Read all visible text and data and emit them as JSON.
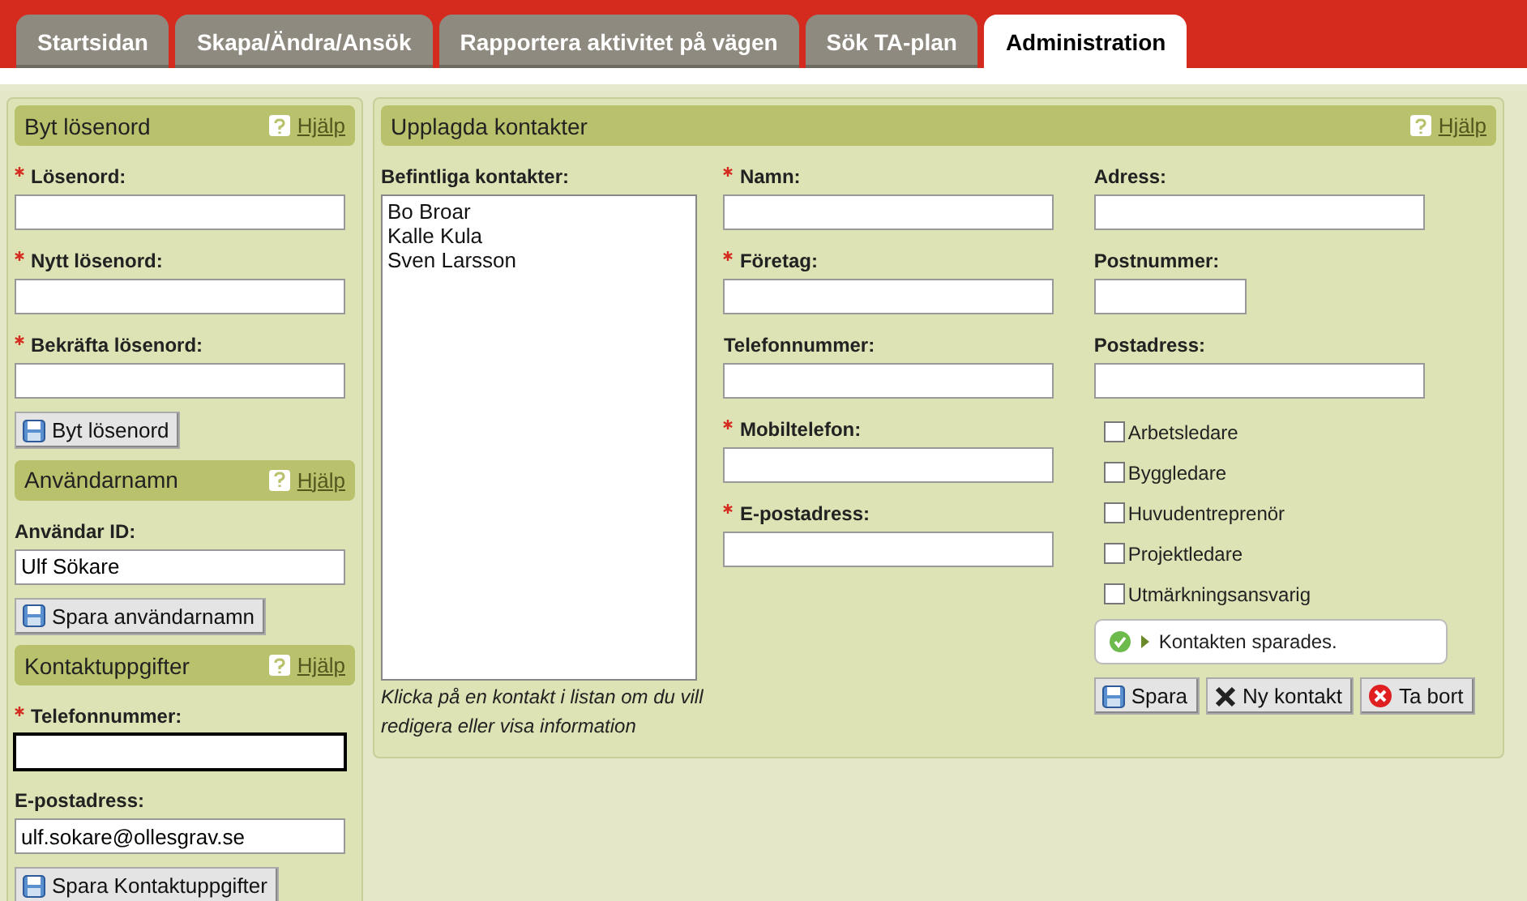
{
  "tabs": [
    {
      "label": "Startsidan",
      "selected": false
    },
    {
      "label": "Skapa/Ändra/Ansök",
      "selected": false
    },
    {
      "label": "Rapportera aktivitet på vägen",
      "selected": false
    },
    {
      "label": "Sök TA-plan",
      "selected": false
    },
    {
      "label": "Administration",
      "selected": true
    }
  ],
  "sidebar": {
    "panels": [
      {
        "title": "Byt lösenord",
        "help": "Hjälp",
        "fields": [
          {
            "label": "Lösenord:",
            "required": true,
            "focused": false
          },
          {
            "label": "Nytt lösenord:",
            "required": true,
            "focused": false
          },
          {
            "label": "Bekräfta lösenord:",
            "required": true,
            "focused": false
          }
        ],
        "button": "Byt lösenord"
      },
      {
        "title": "Användarnamn",
        "help": "Hjälp",
        "fields": [
          {
            "label": "Användar ID:",
            "required": false,
            "value": "Ulf Sökare",
            "focused": false
          }
        ],
        "button": "Spara användarnamn"
      },
      {
        "title": "Kontaktuppgifter",
        "help": "Hjälp",
        "fields": [
          {
            "label": "Telefonnummer:",
            "required": true,
            "focused": true
          },
          {
            "label": "E-postadress:",
            "required": false,
            "value": "ulf.sokare@ollesgrav.se",
            "focused": false
          }
        ],
        "button": "Spara Kontaktuppgifter"
      }
    ]
  },
  "contacts": {
    "title": "Upplagda kontakter",
    "help": "Hjälp",
    "list_label": "Befintliga kontakter:",
    "list": [
      {
        "name": "Bo Broar",
        "selected": false
      },
      {
        "name": "Kalle Kula",
        "selected": false
      },
      {
        "name": "Sven Larsson",
        "selected": false
      }
    ],
    "list_hint": "Klicka på en kontakt i listan om du vill redigera eller visa information",
    "fields": [
      {
        "label": "Namn:",
        "required": true
      },
      {
        "label": "Företag:",
        "required": true
      },
      {
        "label": "Telefonnummer:",
        "required": false
      },
      {
        "label": "Mobiltelefon:",
        "required": true
      },
      {
        "label": "E-postadress:",
        "required": true
      }
    ],
    "address_fields": [
      {
        "label": "Adress:",
        "required": false,
        "kind": "wide"
      },
      {
        "label": "Postnummer:",
        "required": false,
        "kind": "short"
      },
      {
        "label": "Postadress:",
        "required": false,
        "kind": "wide"
      }
    ],
    "roles": [
      {
        "label": "Arbetsledare",
        "checked": false
      },
      {
        "label": "Byggledare",
        "checked": false
      },
      {
        "label": "Huvudentreprenör",
        "checked": false
      },
      {
        "label": "Projektledare",
        "checked": false
      },
      {
        "label": "Utmärkningsansvarig",
        "checked": false
      }
    ],
    "message": {
      "kind": "success",
      "text": "Kontakten sparades."
    },
    "buttons": [
      {
        "kind": "save",
        "label": "Spara"
      },
      {
        "kind": "new",
        "label": "Ny kontakt"
      },
      {
        "kind": "delete",
        "label": "Ta bort"
      }
    ]
  }
}
